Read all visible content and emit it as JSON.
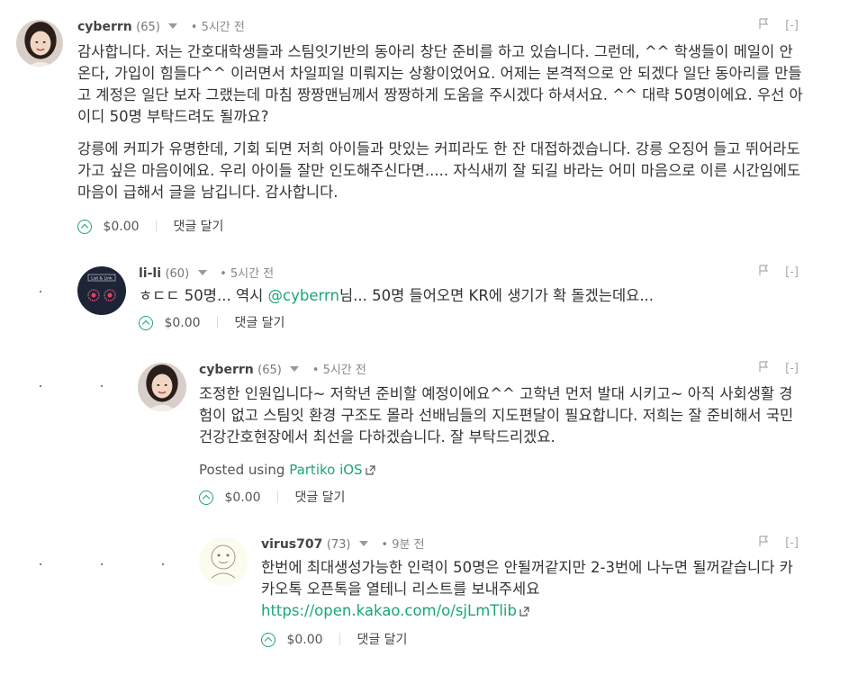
{
  "comments": [
    {
      "author": "cyberrn",
      "reputation": "(65)",
      "time": "• 5시간 전",
      "paragraphs": [
        "감사합니다. 저는 간호대학생들과 스팀잇기반의 동아리 창단 준비를 하고 있습니다. 그런데, ^^ 학생들이 메일이 안 온다, 가입이 힘들다^^ 이러면서 차일피일 미뤄지는 상황이었어요. 어제는 본격적으로 안 되겠다 일단 동아리를 만들고 계정은 일단 보자 그랬는데 마침 짱짱맨님께서 짱짱하게 도움을 주시겠다 하셔서요. ^^ 대략 50명이에요. 우선 아이디 50명 부탁드려도 될까요?",
        "강릉에 커피가 유명한데, 기회 되면 저희 아이들과 맛있는 커피라도 한 잔 대접하겠습니다. 강릉 오징어 들고 뛰어라도 가고 싶은 마음이에요. 우리 아이들 잘만 인도해주신다면..... 자식새끼 잘 되길 바라는 어미 마음으로 이른 시간임에도 마음이 급해서 글을 남깁니다. 감사합니다."
      ],
      "payout": "$0.00",
      "reply_label": "댓글 달기",
      "collapse_label": "[-]"
    },
    {
      "author": "li-li",
      "reputation": "(60)",
      "time": "• 5시간 전",
      "body_prefix": "ㅎㄷㄷ 50명... 역시 ",
      "mention": "@cyberrn",
      "body_suffix": "님... 50명 들어오면 KR에 생기가 확 돌겠는데요...",
      "payout": "$0.00",
      "reply_label": "댓글 달기",
      "collapse_label": "[-]",
      "avatar_text": "List & Link"
    },
    {
      "author": "cyberrn",
      "reputation": "(65)",
      "time": "• 5시간 전",
      "body": "조정한 인원입니다~ 저학년 준비할 예정이에요^^ 고학년 먼저 발대 시키고~ 아직 사회생활 경험이 없고 스팀잇 환경 구조도 몰라 선배님들의 지도편달이 필요합니다. 저희는 잘 준비해서 국민건강간호현장에서 최선을 다하겠습니다. 잘 부탁드리겠요.",
      "posted_using_prefix": "Posted using ",
      "posted_using_link": "Partiko iOS",
      "payout": "$0.00",
      "reply_label": "댓글 달기",
      "collapse_label": "[-]"
    },
    {
      "author": "virus707",
      "reputation": "(73)",
      "time": "• 9분 전",
      "body": "한번에 최대생성가능한 인력이 50명은 안될꺼같지만 2-3번에 나누면 될꺼같습니다 카카오톡 오픈톡을 열테니 리스트를 보내주세요",
      "link": "https://open.kakao.com/o/sjLmTlib",
      "payout": "$0.00",
      "reply_label": "댓글 달기",
      "collapse_label": "[-]"
    }
  ],
  "colors": {
    "accent": "#1aa57a",
    "text": "#333333",
    "muted": "#888888"
  },
  "icons": [
    "flag-icon",
    "upvote-icon",
    "external-link-icon",
    "caret-down-icon"
  ]
}
